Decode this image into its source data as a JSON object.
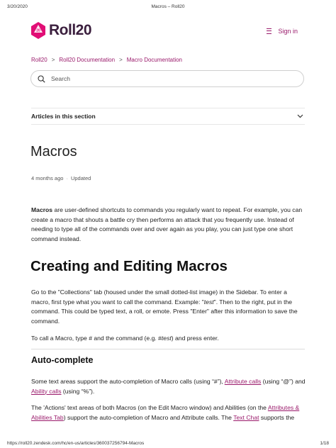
{
  "print": {
    "date": "3/20/2020",
    "title": "Macros – Roll20",
    "url": "https://roll20.zendesk.com/hc/en-us/articles/360037256794-Macros",
    "pages": "1/18"
  },
  "header": {
    "brand": "Roll20",
    "signin_label": "Sign in",
    "brand_color": "#9a1a6b"
  },
  "breadcrumbs": [
    "Roll20",
    "Roll20 Documentation",
    "Macro Documentation"
  ],
  "search": {
    "placeholder": "Search"
  },
  "articles_section": {
    "label": "Articles in this section"
  },
  "article": {
    "title": "Macros",
    "updated_ago": "4 months ago",
    "updated_label": "Updated",
    "intro": {
      "bold": "Macros",
      "text": " are user-defined shortcuts to commands you regularly want to repeat. For example, you can create a macro that shouts a battle cry then performs an attack that you frequently use. Instead of needing to type all of the commands over and over again as you play, you can just type one short command instead."
    },
    "section1": {
      "heading": "Creating and Editing Macros",
      "p1": {
        "a": "Go to the \"Collections\" tab (housed under the small dotted-list image) in the Sidebar. To enter a macro, first type what you want to call the command. Example: \"",
        "em": "test",
        "b": "\". Then to the right, put in the command. This could be typed text, a roll, or emote. Press \"Enter\" after this information to save the command."
      },
      "p2": {
        "a": "To call a Macro, type # and the command (e.g. #",
        "em": "test",
        "b": ") and press enter."
      }
    },
    "section2": {
      "heading": "Auto-complete",
      "p3": {
        "a": "Some text areas support the auto-completion of Macro calls (using “#”), ",
        "link1": "Attribute calls",
        "b": " (using “@”) and ",
        "link2": "Ability calls",
        "c": " (using “%”)."
      },
      "p4": {
        "a": "The 'Actions' text areas of both Macros (on the Edit Macro window) and Abilities (on the ",
        "link1": "Attributes & Abilities Tab",
        "b": ") support the auto-completion of Macro and Attribute calls. The ",
        "link2": "Text Chat",
        "c": " supports the"
      }
    }
  }
}
